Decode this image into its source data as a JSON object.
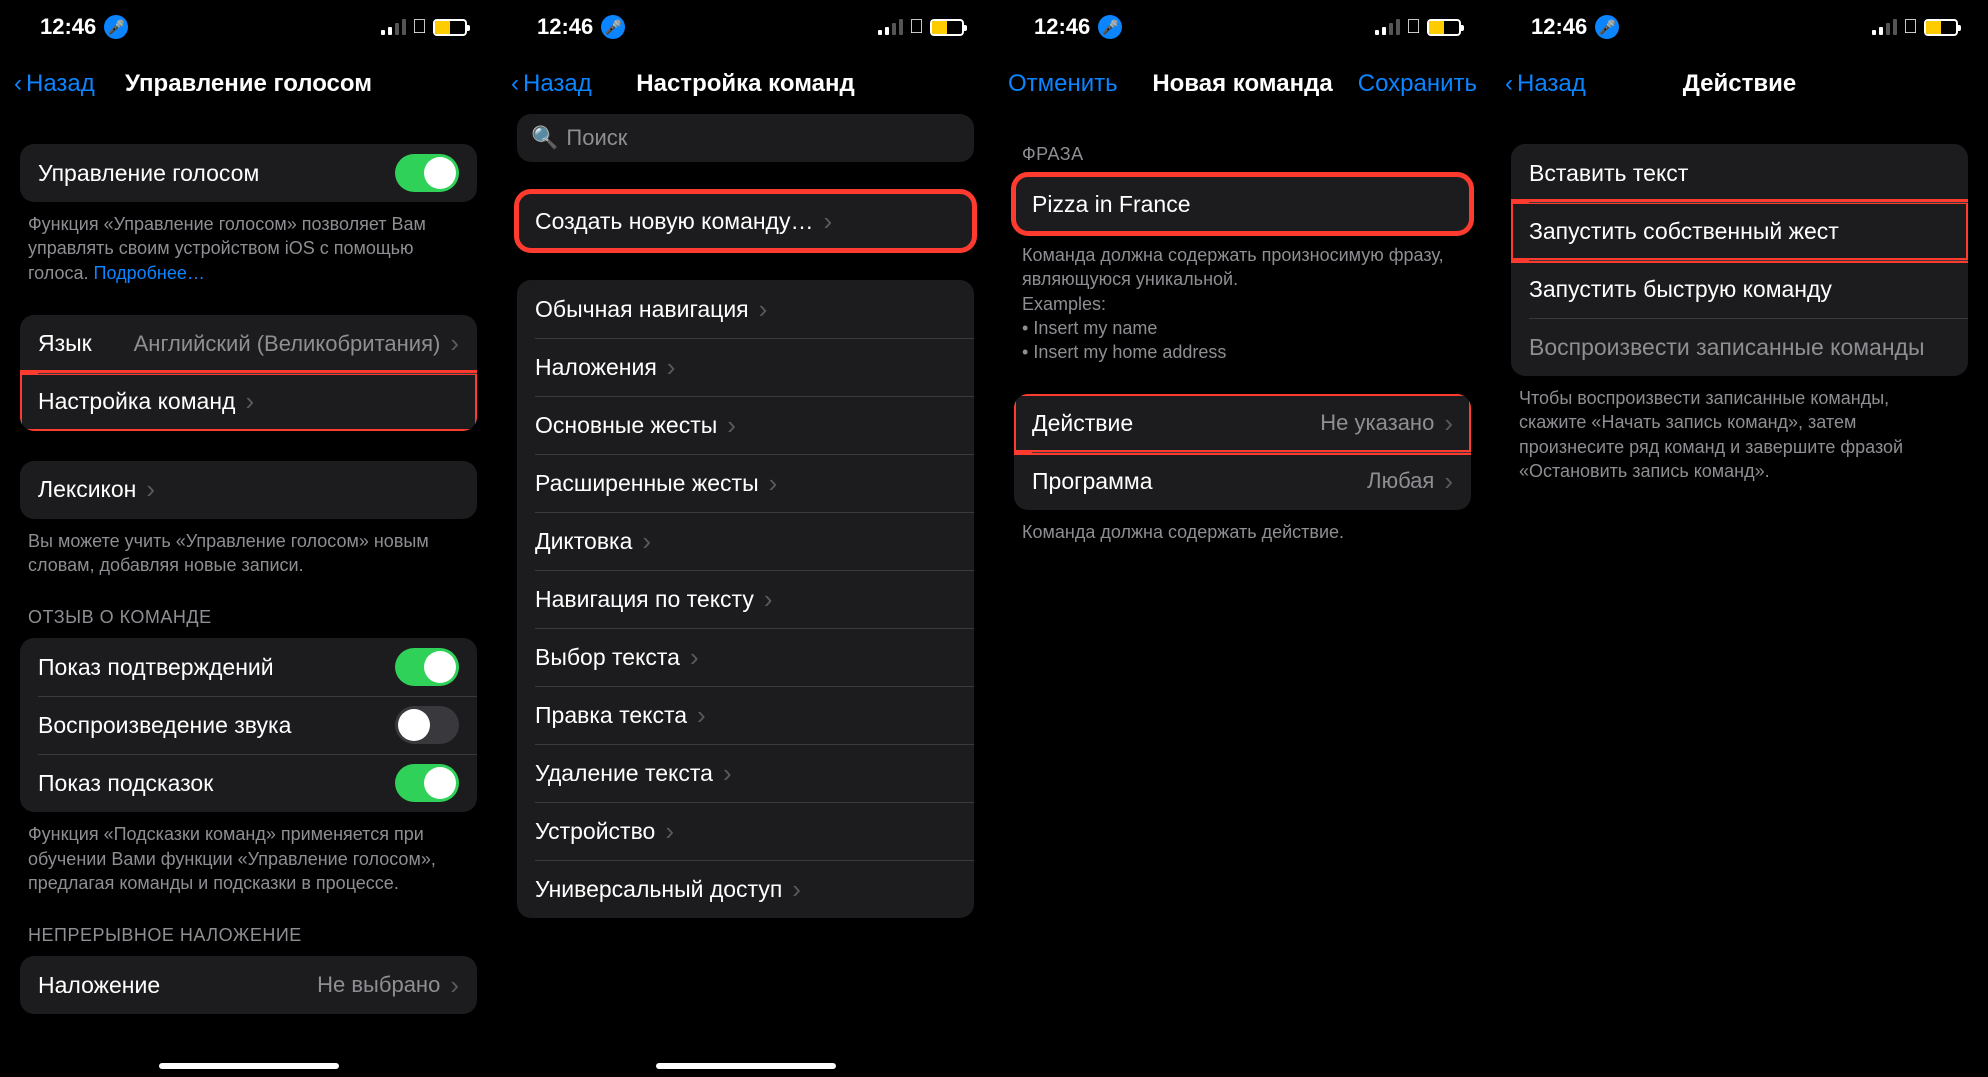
{
  "status": {
    "time": "12:46"
  },
  "common": {
    "back": "Назад"
  },
  "s1": {
    "title": "Управление голосом",
    "voiceControl": "Управление голосом",
    "vcFooter": "Функция «Управление голосом» позволяет Вам управлять своим устройством iOS с помощью голоса. ",
    "vcMore": "Подробнее…",
    "language": "Язык",
    "languageValue": "Английский (Великобритания)",
    "customize": "Настройка команд",
    "vocab": "Лексикон",
    "vocabFooter": "Вы можете учить «Управление голосом» новым словам, добавляя новые записи.",
    "feedbackHeader": "ОТЗЫВ О КОМАНДЕ",
    "showConfirm": "Показ подтверждений",
    "playSound": "Воспроизведение звука",
    "showHints": "Показ подсказок",
    "hintsFooter": "Функция «Подсказки команд» применяется при обучении Вами функции «Управление голосом», предлагая команды и подсказки в процессе.",
    "overlayHeader": "НЕПРЕРЫВНОЕ НАЛОЖЕНИЕ",
    "overlay": "Наложение",
    "overlayValue": "Не выбрано"
  },
  "s2": {
    "title": "Настройка команд",
    "searchPlaceholder": "Поиск",
    "create": "Создать новую команду…",
    "cats": {
      "basicNav": "Обычная навигация",
      "overlays": "Наложения",
      "basicGest": "Основные жесты",
      "advGest": "Расширенные жесты",
      "dictation": "Диктовка",
      "textNav": "Навигация по тексту",
      "textSel": "Выбор текста",
      "textEdit": "Правка текста",
      "textDel": "Удаление текста",
      "device": "Устройство",
      "accessibility": "Универсальный доступ"
    }
  },
  "s3": {
    "cancel": "Отменить",
    "title": "Новая команда",
    "save": "Сохранить",
    "phraseHeader": "ФРАЗА",
    "phraseValue": "Pizza in France",
    "phraseFooter1": "Команда должна содержать произносимую фразу, являющуюся уникальной.",
    "examplesLabel": "Examples:",
    "ex1": "Insert my name",
    "ex2": "Insert my home address",
    "action": "Действие",
    "actionValue": "Не указано",
    "app": "Программа",
    "appValue": "Любая",
    "actionFooter": "Команда должна содержать действие."
  },
  "s4": {
    "title": "Действие",
    "insertText": "Вставить текст",
    "customGesture": "Запустить собственный жест",
    "shortcut": "Запустить быструю команду",
    "playback": "Воспроизвести записанные команды",
    "playbackFooter": "Чтобы воспроизвести записанные команды, скажите «Начать запись команд», затем произнесите ряд команд и завершите фразой «Остановить запись команд»."
  }
}
